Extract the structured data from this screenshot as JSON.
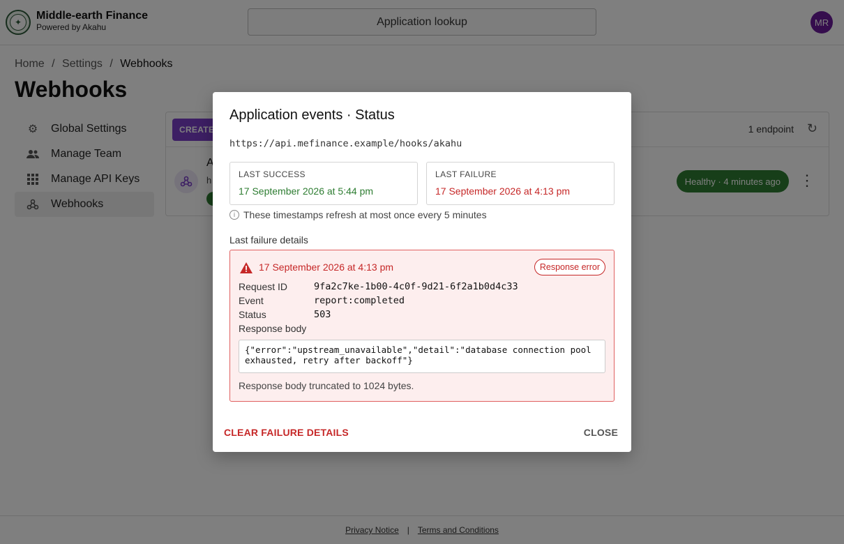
{
  "header": {
    "brand_name": "Middle-earth Finance",
    "brand_sub": "Powered by Akahu",
    "lookup_label": "Application lookup",
    "avatar_initials": "MR"
  },
  "breadcrumb": [
    "Home",
    "/",
    "Settings",
    "/",
    "Webhooks"
  ],
  "page_title": "Webhooks",
  "sidebar": {
    "items": [
      {
        "label": "Global Settings",
        "icon": "gear-icon"
      },
      {
        "label": "Manage Team",
        "icon": "team-icon"
      },
      {
        "label": "Manage API Keys",
        "icon": "grid-icon"
      },
      {
        "label": "Webhooks",
        "icon": "webhook-icon"
      }
    ]
  },
  "panel": {
    "create_label": "CREATE",
    "endpoint_count": "1 endpoint",
    "row_title_fragment": "A",
    "row_url_fragment": "h",
    "health_chip": "Healthy · 4 minutes ago"
  },
  "modal": {
    "title": "Application events · Status",
    "url": "https://api.mefinance.example/hooks/akahu",
    "last_success_label": "LAST SUCCESS",
    "last_success_value": "17 September 2026 at 5:44 pm",
    "last_failure_label": "LAST FAILURE",
    "last_failure_value": "17 September 2026 at 4:13 pm",
    "note": "These timestamps refresh at most once every 5 minutes",
    "details_label": "Last failure details",
    "failure": {
      "date": "17 September 2026 at 4:13 pm",
      "chip": "Response error",
      "request_id_label": "Request ID",
      "request_id": "9fa2c7ke-1b00-4c0f-9d21-6f2a1b0d4c33",
      "event_label": "Event",
      "event": "report:completed",
      "status_label": "Status",
      "status": "503",
      "response_body_label": "Response body",
      "response_body": "{\"error\":\"upstream_unavailable\",\"detail\":\"database connection pool exhausted, retry after backoff\"}",
      "truncated_note": "Response body truncated to 1024 bytes."
    },
    "clear_label": "CLEAR FAILURE DETAILS",
    "close_label": "CLOSE"
  },
  "footer": {
    "privacy": "Privacy Notice",
    "separator": "|",
    "terms": "Terms and Conditions"
  },
  "colors": {
    "accent": "#7b3fc9",
    "success": "#2e7d32",
    "error": "#c62828"
  }
}
